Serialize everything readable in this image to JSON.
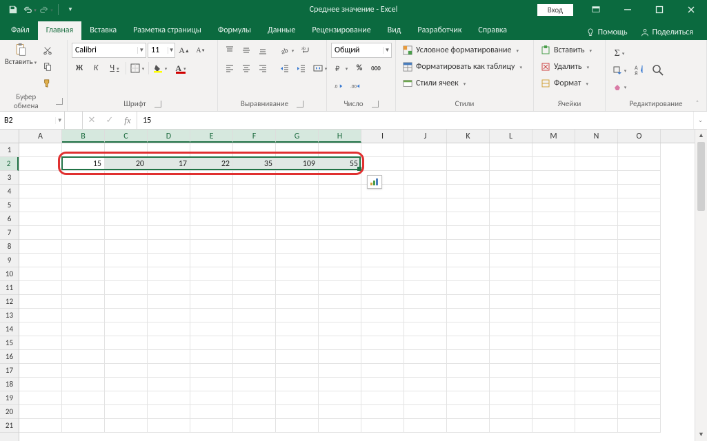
{
  "title": "Среднее значение - Excel",
  "qat": {
    "save": "save-icon",
    "undo": "undo-icon",
    "redo": "redo-icon"
  },
  "login_label": "Вход",
  "tabs": {
    "file": "Файл",
    "items": [
      "Главная",
      "Вставка",
      "Разметка страницы",
      "Формулы",
      "Данные",
      "Рецензирование",
      "Вид",
      "Разработчик",
      "Справка"
    ],
    "active_index": 0,
    "assist": "Помощь",
    "share": "Поделиться"
  },
  "ribbon": {
    "clipboard": {
      "paste": "Вставить",
      "label": "Буфер обмена"
    },
    "font": {
      "label": "Шрифт",
      "name": "Calibri",
      "size": "11",
      "bold": "Ж",
      "italic": "К",
      "underline": "Ч"
    },
    "alignment": {
      "label": "Выравнивание"
    },
    "number": {
      "label": "Число",
      "format": "Общий"
    },
    "styles": {
      "label": "Стили",
      "cond": "Условное форматирование",
      "table": "Форматировать как таблицу",
      "cell": "Стили ячеек"
    },
    "cells": {
      "label": "Ячейки",
      "insert": "Вставить",
      "delete": "Удалить",
      "format": "Формат"
    },
    "editing": {
      "label": "Редактирование"
    }
  },
  "namebox": "B2",
  "formula": "15",
  "grid": {
    "columns": [
      "A",
      "B",
      "C",
      "D",
      "E",
      "F",
      "G",
      "H",
      "I",
      "J",
      "K",
      "L",
      "M",
      "N",
      "O"
    ],
    "selected_cols": [
      "B",
      "C",
      "D",
      "E",
      "F",
      "G",
      "H"
    ],
    "rows": 21,
    "selected_row": 2,
    "data_row": 2,
    "values": {
      "B": "15",
      "C": "20",
      "D": "17",
      "E": "22",
      "F": "35",
      "G": "109",
      "H": "55"
    },
    "selection": {
      "from_col": "B",
      "to_col": "H",
      "row": 2
    }
  }
}
